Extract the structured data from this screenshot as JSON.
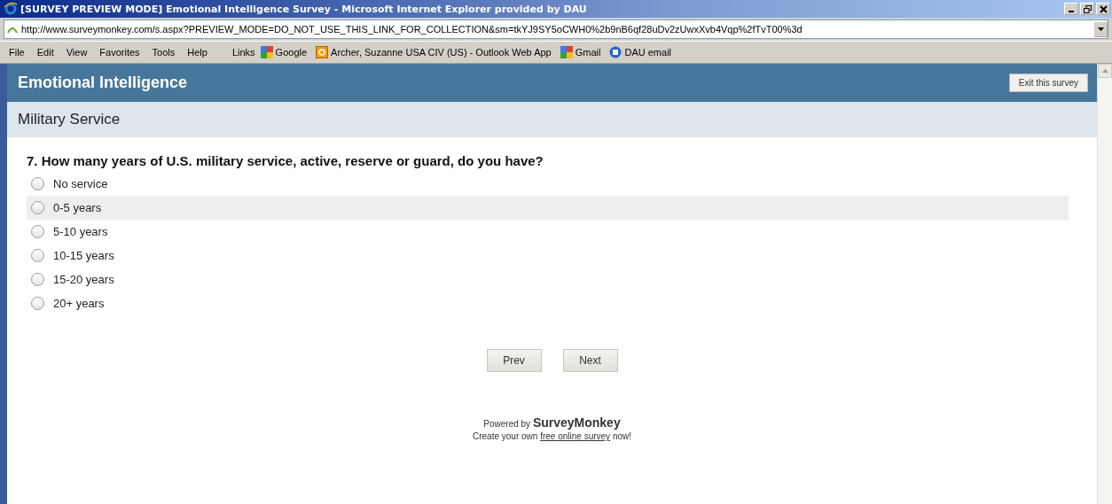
{
  "window": {
    "title": "[SURVEY PREVIEW MODE] Emotional Intelligence Survey - Microsoft Internet Explorer provided by DAU"
  },
  "address_bar": {
    "value": "http://www.surveymonkey.com/s.aspx?PREVIEW_MODE=DO_NOT_USE_THIS_LINK_FOR_COLLECTION&sm=tkYJ9SY5oCWH0%2b9nB6qf28uDv2zUwxXvb4Vqp%2fTvT00%3d"
  },
  "menu": [
    "File",
    "Edit",
    "View",
    "Favorites",
    "Tools",
    "Help"
  ],
  "links_label": "Links",
  "links": [
    {
      "label": "Google",
      "kind": "google"
    },
    {
      "label": "Archer, Suzanne USA CIV (US) - Outlook Web App",
      "kind": "outlook"
    },
    {
      "label": "Gmail",
      "kind": "google"
    },
    {
      "label": "DAU email",
      "kind": "ie"
    }
  ],
  "survey": {
    "title": "Emotional Intelligence",
    "exit_button": "Exit this survey",
    "section": "Military Service",
    "question": "7. How many years of U.S. military service, active, reserve or guard, do you have?",
    "options": [
      {
        "label": "No service",
        "selected": false,
        "highlighted": false
      },
      {
        "label": "0-5 years",
        "selected": false,
        "highlighted": true
      },
      {
        "label": "5-10 years",
        "selected": false,
        "highlighted": false
      },
      {
        "label": "10-15 years",
        "selected": false,
        "highlighted": false
      },
      {
        "label": "15-20 years",
        "selected": false,
        "highlighted": false
      },
      {
        "label": "20+ years",
        "selected": false,
        "highlighted": false
      }
    ],
    "buttons": [
      "Prev",
      "Next"
    ]
  },
  "footer": {
    "powered_by": "Powered by",
    "brand": "SurveyMonkey",
    "text_before": "Create your own",
    "link": "free online survey",
    "text_after": "now!"
  }
}
